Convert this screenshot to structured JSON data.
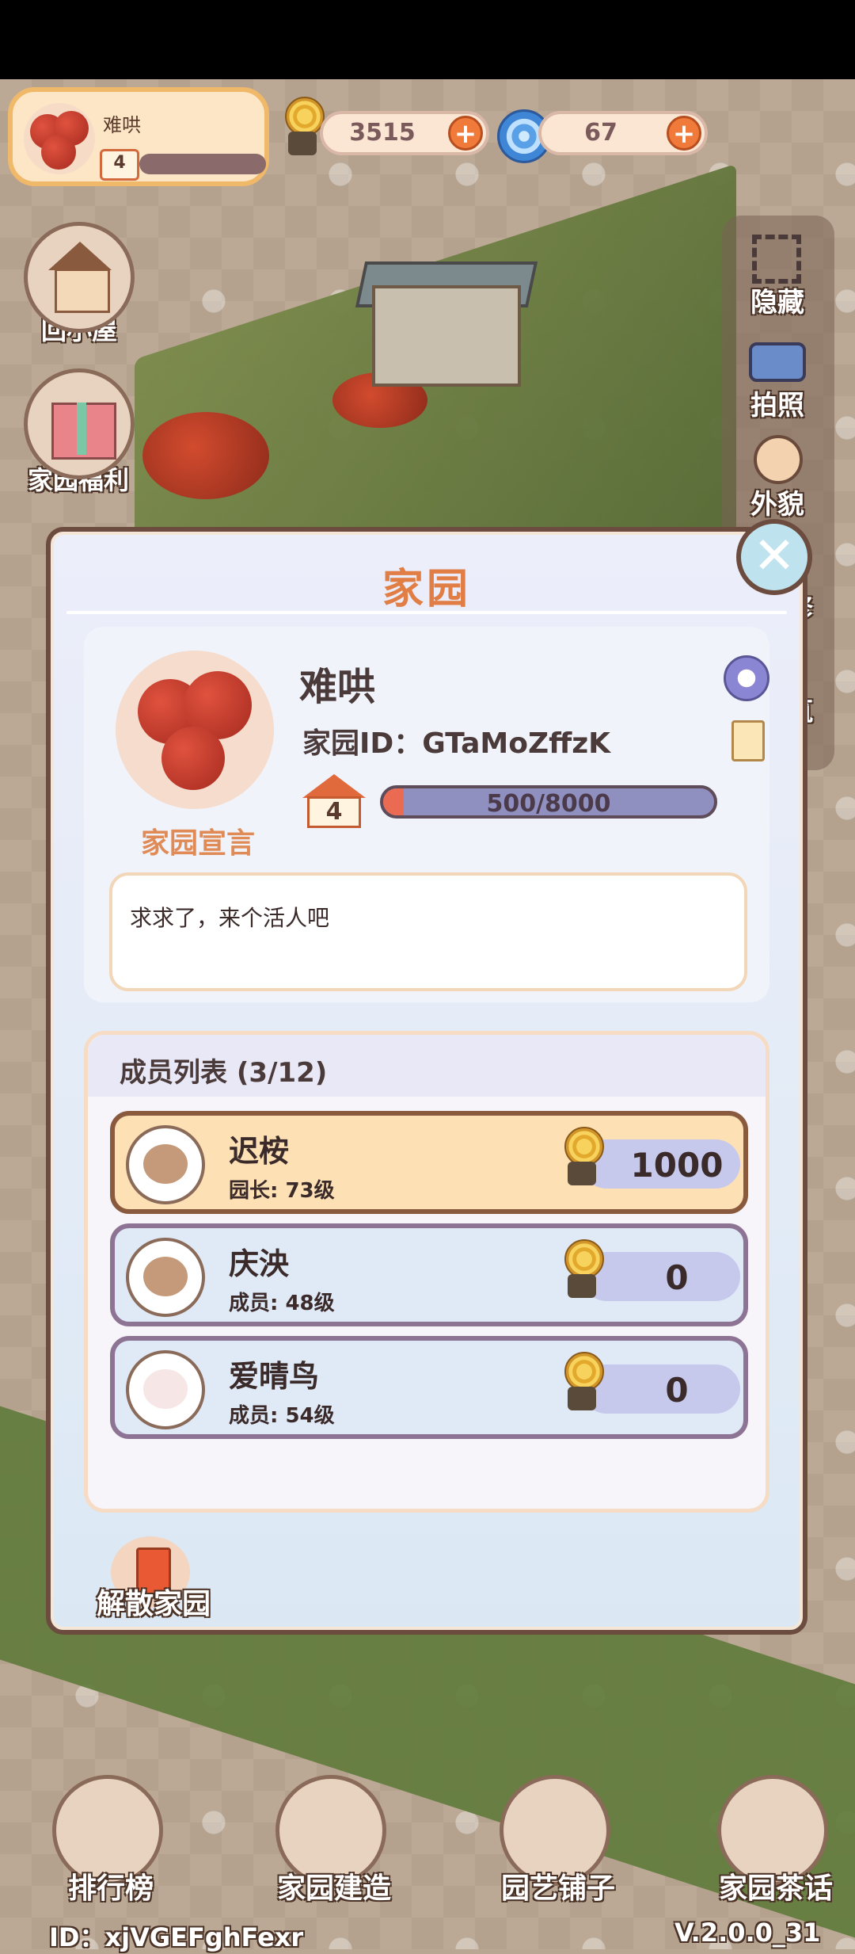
{
  "hud": {
    "player_name": "难哄",
    "player_level": "4",
    "snail_coins": "3515",
    "spiral_gems": "67"
  },
  "side_left": {
    "home_label": "回小屋",
    "welfare_label": "家园福利"
  },
  "side_right": {
    "hide_label": "隐藏",
    "photo_label": "拍照",
    "appearance_label": "外貌",
    "repair_partial": "修",
    "build_partial": "筑"
  },
  "modal": {
    "title": "家园",
    "owner_name": "难哄",
    "garden_id": "家园ID：GTaMoZffzK",
    "level": "4",
    "xp_text": "500/8000",
    "xp_fraction": 0.0625,
    "declaration_label": "家园宣言",
    "declaration_text": "求求了，来个活人吧",
    "member_title": "成员列表 (3/12)",
    "members": [
      {
        "name": "迟桉",
        "role": "园长: 73级",
        "score": "1000"
      },
      {
        "name": "庆泱",
        "role": "成员: 48级",
        "score": "0"
      },
      {
        "name": "爱晴鸟",
        "role": "成员: 54级",
        "score": "0"
      }
    ],
    "disband_label": "解散家园"
  },
  "bottom_nav": {
    "rank_label": "排行榜",
    "build_label": "家园建造",
    "shop_label": "园艺铺子",
    "chat_label": "家园茶话"
  },
  "footer": {
    "user_id": "ID：xjVGEFghFexr",
    "version": "V.2.0.0_31"
  },
  "colors": {
    "title_accent": "#e07e46",
    "modal_border": "#6c4c3e",
    "xp_fill": "#ea6b52"
  }
}
